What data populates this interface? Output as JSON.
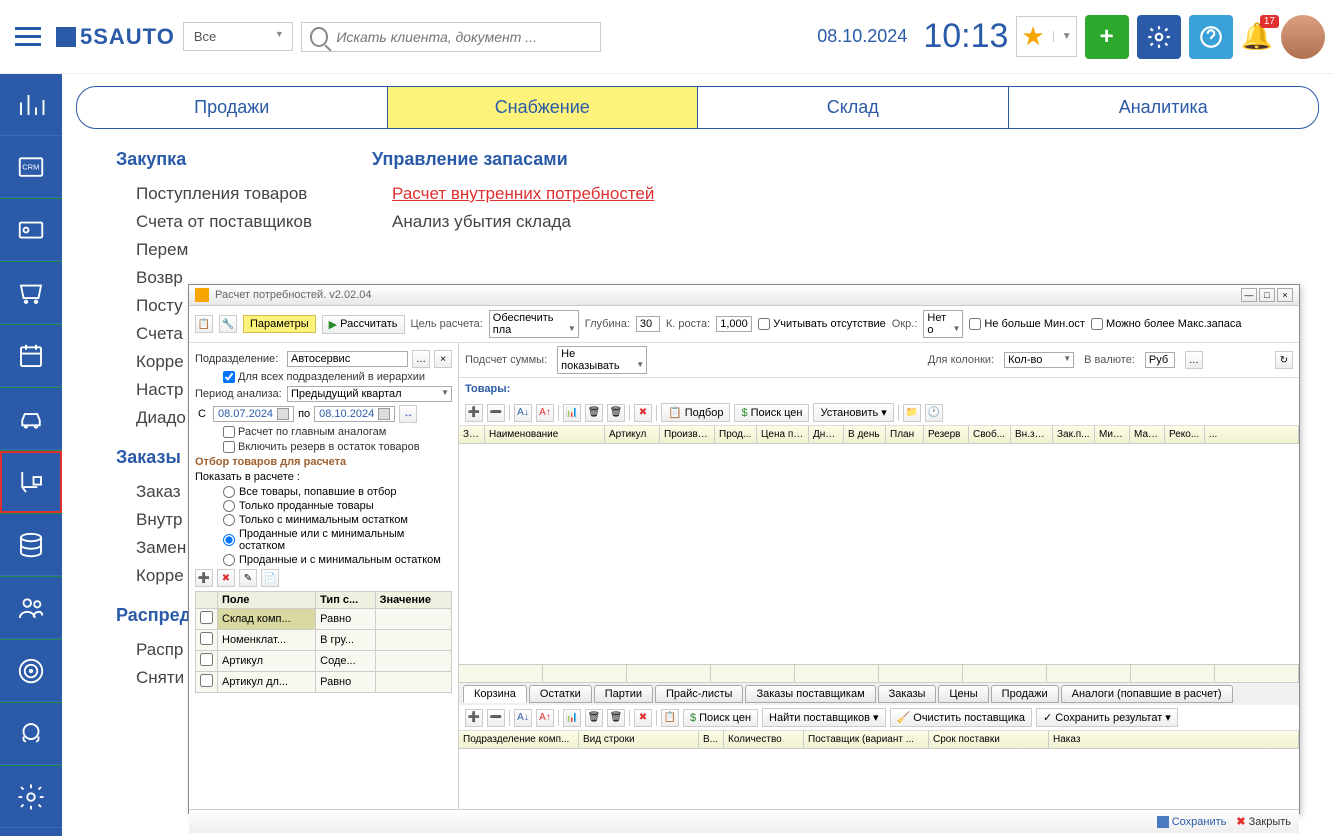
{
  "topbar": {
    "logo": "5SAUTO",
    "filter_all": "Все",
    "search_placeholder": "Искать клиента, документ ...",
    "date": "08.10.2024",
    "time": "10:13",
    "badge_count": "17"
  },
  "nav_tabs": [
    "Продажи",
    "Снабжение",
    "Склад",
    "Аналитика"
  ],
  "nav_active_index": 1,
  "menu": {
    "col1": {
      "title": "Закупка",
      "items": [
        "Поступления товаров",
        "Счета от поставщиков",
        "Перем",
        "Возвр",
        "Посту",
        "Счета",
        "Корре",
        "Настр",
        "Диадо"
      ]
    },
    "col2": {
      "title": "Управление запасами",
      "items": [
        "Расчет внутренних потребностей",
        "Анализ убытия склада"
      ]
    },
    "col3": {
      "title": "Заказы",
      "items": [
        "Заказ",
        "Внутр",
        "Замен",
        "Корре"
      ]
    },
    "col4": {
      "title": "Распред",
      "items": [
        "Распр",
        "Сняти"
      ]
    }
  },
  "dialog": {
    "title": "Расчет потребностей. v2.02.04",
    "toolbar1": {
      "parameters": "Параметры",
      "calculate": "Рассчитать",
      "goal_label": "Цель расчета:",
      "goal_value": "Обеспечить пла",
      "depth_label": "Глубина:",
      "depth_value": "30",
      "growth_label": "К. роста:",
      "growth_value": "1,000",
      "consider_absence": "Учитывать отсутствие",
      "round_label": "Окр.:",
      "round_value": "Нет о",
      "not_more_min": "Не больше Мин.ост",
      "can_more_max": "Можно более Макс.запаса"
    },
    "left_panel": {
      "subdivision_label": "Подразделение:",
      "subdivision_value": "Автосервис",
      "for_all_subdivisions": "Для всех подразделений в иерархии",
      "period_label": "Период анализа:",
      "period_value": "Предыдущий квартал",
      "from_label": "С",
      "from_date": "08.07.2024",
      "to_label": "по",
      "to_date": "08.10.2024",
      "calc_by_analogs": "Расчет по главным аналогам",
      "include_reserve": "Включить резерв в остаток товаров",
      "filter_section": "Отбор товаров для расчета",
      "show_in_calc": "Показать в расчете :",
      "radio_options": [
        "Все товары, попавшие в отбор",
        "Только проданные товары",
        "Только с минимальным остатком",
        "Проданные или с минимальным остатком",
        "Проданные и с минимальным остатком"
      ],
      "radio_selected": 3,
      "filter_table": {
        "headers": [
          "Поле",
          "Тип с...",
          "Значение"
        ],
        "rows": [
          {
            "field": "Склад комп...",
            "type": "Равно",
            "value": ""
          },
          {
            "field": "Номенклат...",
            "type": "В гру...",
            "value": ""
          },
          {
            "field": "Артикул",
            "type": "Соде...",
            "value": ""
          },
          {
            "field": "Артикул дл...",
            "type": "Равно",
            "value": ""
          }
        ]
      }
    },
    "right_panel": {
      "sum_label": "Подсчет суммы:",
      "sum_value": "Не показывать",
      "for_column_label": "Для колонки:",
      "for_column_value": "Кол-во",
      "currency_label": "В валюте:",
      "currency_value": "Руб",
      "goods_label": "Товары:",
      "toolbar_buttons": {
        "selection": "Подбор",
        "price_search": "Поиск цен",
        "set": "Установить"
      },
      "grid_columns": [
        "За...",
        "Наименование",
        "Артикул",
        "Произво...",
        "Прод...",
        "Цена пр...",
        "Дне...",
        "В день",
        "План",
        "Резерв",
        "Своб...",
        "Вн.за...",
        "Зак.п...",
        "Мин...",
        "Мак...",
        "Реко...",
        "..."
      ],
      "bottom_tabs": [
        "Корзина",
        "Остатки",
        "Партии",
        "Прайс-листы",
        "Заказы поставщикам",
        "Заказы",
        "Цены",
        "Продажи",
        "Аналоги (попавшие в расчет)"
      ],
      "bottom_tab_active": 0,
      "lower_toolbar": {
        "price_search": "Поиск цен",
        "find_suppliers": "Найти поставщиков",
        "clear_supplier": "Очистить поставщика",
        "save_result": "Сохранить результат"
      },
      "lower_columns": [
        "Подразделение комп...",
        "Вид строки",
        "В...",
        "Количество",
        "Поставщик (вариант ...",
        "Срок поставки",
        "Наказ"
      ]
    },
    "footer": {
      "save": "Сохранить",
      "close": "Закрыть"
    }
  }
}
